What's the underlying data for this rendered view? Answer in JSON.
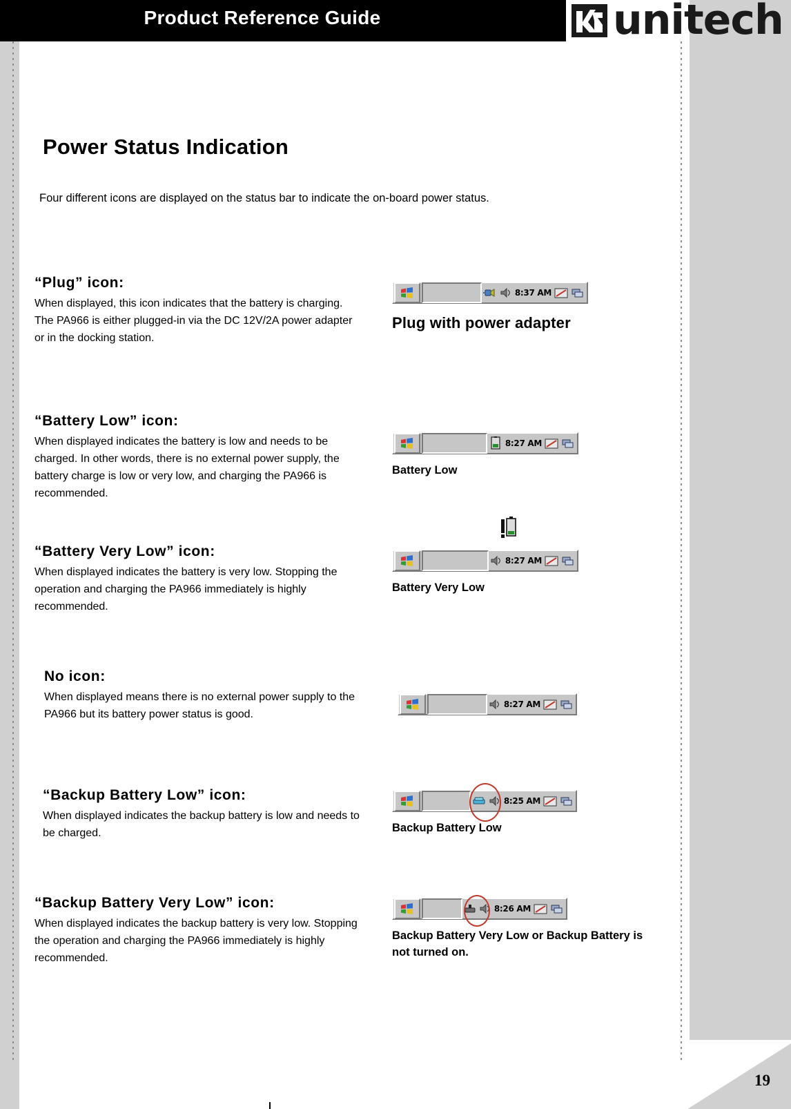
{
  "header": {
    "title": "Product Reference Guide",
    "logo_text": "unitech",
    "logo_mark": "unitech-logo-icon"
  },
  "page": {
    "number": "19",
    "section_title": "Power Status Indication",
    "intro": "Four different icons are displayed on the status bar to indicate the on-board power status."
  },
  "entries": [
    {
      "heading": "“Plug” icon:",
      "body": "When displayed, this icon indicates that the battery is charging.  The PA966 is either plugged-in via the DC 12V/2A power adapter or in the docking station.",
      "caption": "Plug with power adapter",
      "time": "8:37 AM"
    },
    {
      "heading": "“Battery Low” icon:",
      "body": "When displayed indicates the battery is low and needs to be charged.  In other words, there is no external power supply, the battery charge is low or very low, and charging the PA966 is recommended.",
      "caption": "Battery Low",
      "time": "8:27 AM"
    },
    {
      "heading": "“Battery Very Low” icon:",
      "body": "When displayed indicates the battery is very low. Stopping the operation and charging the PA966 immediately is highly recommended.",
      "caption": "Battery Very Low",
      "time": "8:27 AM"
    },
    {
      "heading": "No icon:",
      "body": "When displayed means there is no external power supply to the PA966 but its battery power status is good.",
      "caption": "",
      "time": "8:27 AM"
    },
    {
      "heading": "“Backup Battery Low” icon:",
      "body": "When displayed indicates the backup battery is low and needs to be charged.",
      "caption": "Backup Battery Low",
      "time": "8:25 AM"
    },
    {
      "heading": "“Backup Battery Very Low” icon:",
      "body": "When displayed indicates the backup battery is very low.  Stopping the operation and charging the PA966 immediately is highly recommended.",
      "caption": "Backup Battery Very Low or Backup Battery is not turned on.",
      "time": "8:26 AM"
    }
  ],
  "colors": {
    "header_bg": "#000000",
    "band_grey": "#d0d0d0",
    "taskbar_grey": "#c6c6c6",
    "annotation_red": "#c0392b"
  }
}
